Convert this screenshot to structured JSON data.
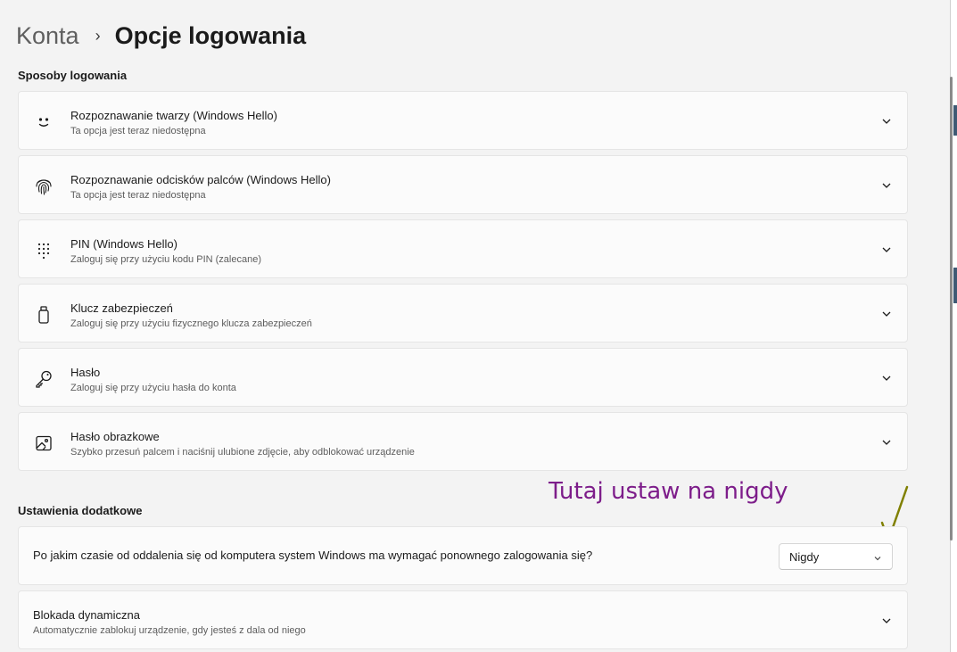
{
  "breadcrumb": {
    "parent": "Konta",
    "separator": "›",
    "current": "Opcje logowania"
  },
  "sections": {
    "signin_methods": "Sposoby logowania",
    "additional": "Ustawienia dodatkowe"
  },
  "signin_methods": [
    {
      "icon": "face-icon",
      "title": "Rozpoznawanie twarzy (Windows Hello)",
      "subtitle": "Ta opcja jest teraz niedostępna"
    },
    {
      "icon": "fingerprint-icon",
      "title": "Rozpoznawanie odcisków palców (Windows Hello)",
      "subtitle": "Ta opcja jest teraz niedostępna"
    },
    {
      "icon": "pin-keypad-icon",
      "title": "PIN (Windows Hello)",
      "subtitle": "Zaloguj się przy użyciu kodu PIN (zalecane)"
    },
    {
      "icon": "usb-key-icon",
      "title": "Klucz zabezpieczeń",
      "subtitle": "Zaloguj się przy użyciu fizycznego klucza zabezpieczeń"
    },
    {
      "icon": "key-icon",
      "title": "Hasło",
      "subtitle": "Zaloguj się przy użyciu hasła do konta"
    },
    {
      "icon": "picture-icon",
      "title": "Hasło obrazkowe",
      "subtitle": "Szybko przesuń palcem i naciśnij ulubione zdjęcie, aby odblokować urządzenie"
    }
  ],
  "additional": {
    "require_signin": {
      "question": "Po jakim czasie od oddalenia się od komputera system Windows ma wymagać ponownego zalogowania się?",
      "selected": "Nigdy"
    },
    "dynamic_lock": {
      "title": "Blokada dynamiczna",
      "subtitle": "Automatycznie zablokuj urządzenie, gdy jesteś z dala od niego"
    }
  },
  "annotation": {
    "text": "Tutaj ustaw na nigdy",
    "text_color": "#7d1d8a",
    "arrow_color": "#808000"
  }
}
